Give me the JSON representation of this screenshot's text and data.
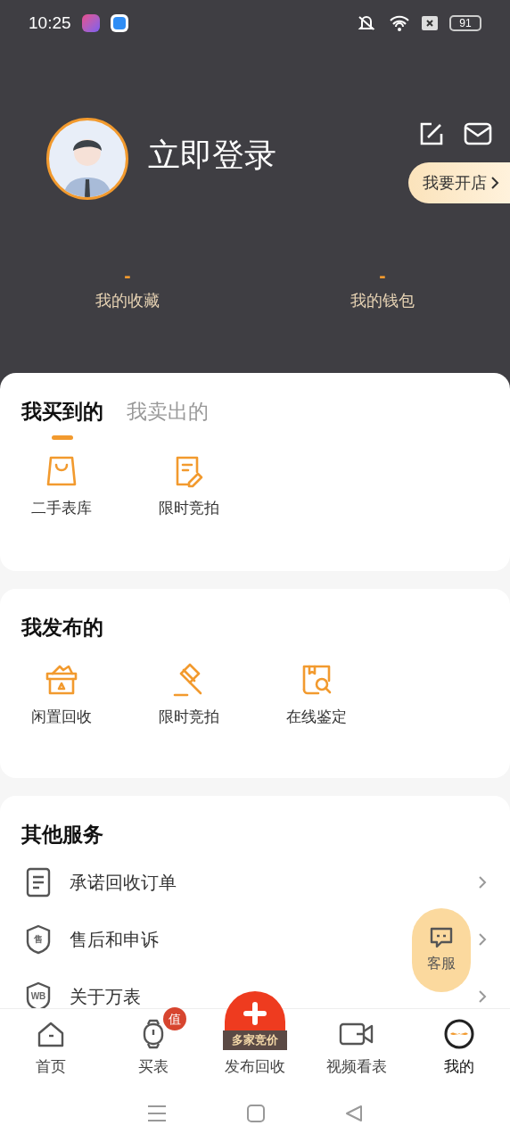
{
  "status_bar": {
    "time": "10:25",
    "battery": "91"
  },
  "profile": {
    "login": "立即登录",
    "open_shop": "我要开店"
  },
  "stats": [
    {
      "value": "-",
      "label": "我的收藏"
    },
    {
      "value": "-",
      "label": "我的钱包"
    }
  ],
  "order_tabs": [
    {
      "label": "我买到的",
      "selected": true
    },
    {
      "label": "我卖出的",
      "selected": false
    }
  ],
  "bought_items": [
    {
      "label": "二手表库",
      "kind": "bag"
    },
    {
      "label": "限时竞拍",
      "kind": "note"
    }
  ],
  "published": {
    "title": "我发布的",
    "items": [
      {
        "label": "闲置回收",
        "kind": "box"
      },
      {
        "label": "限时竞拍",
        "kind": "gavel"
      },
      {
        "label": "在线鉴定",
        "kind": "inspect"
      }
    ]
  },
  "services": {
    "title": "其他服务",
    "rows": [
      {
        "label": "承诺回收订单",
        "kind": "doc"
      },
      {
        "label": "售后和申诉",
        "kind": "shield",
        "icon_text": "售"
      },
      {
        "label": "关于万表",
        "kind": "shield",
        "icon_text": "WB"
      }
    ]
  },
  "float_button": {
    "label": "客服"
  },
  "bottom_nav": [
    {
      "label": "首页",
      "kind": "home",
      "selected": false
    },
    {
      "label": "买表",
      "kind": "watch",
      "selected": false,
      "badge": "值"
    },
    {
      "label": "发布回收",
      "kind": "publish",
      "selected": false,
      "ribbon": "多家竞价"
    },
    {
      "label": "视频看表",
      "kind": "video",
      "selected": false
    },
    {
      "label": "我的",
      "kind": "me",
      "selected": true
    }
  ]
}
